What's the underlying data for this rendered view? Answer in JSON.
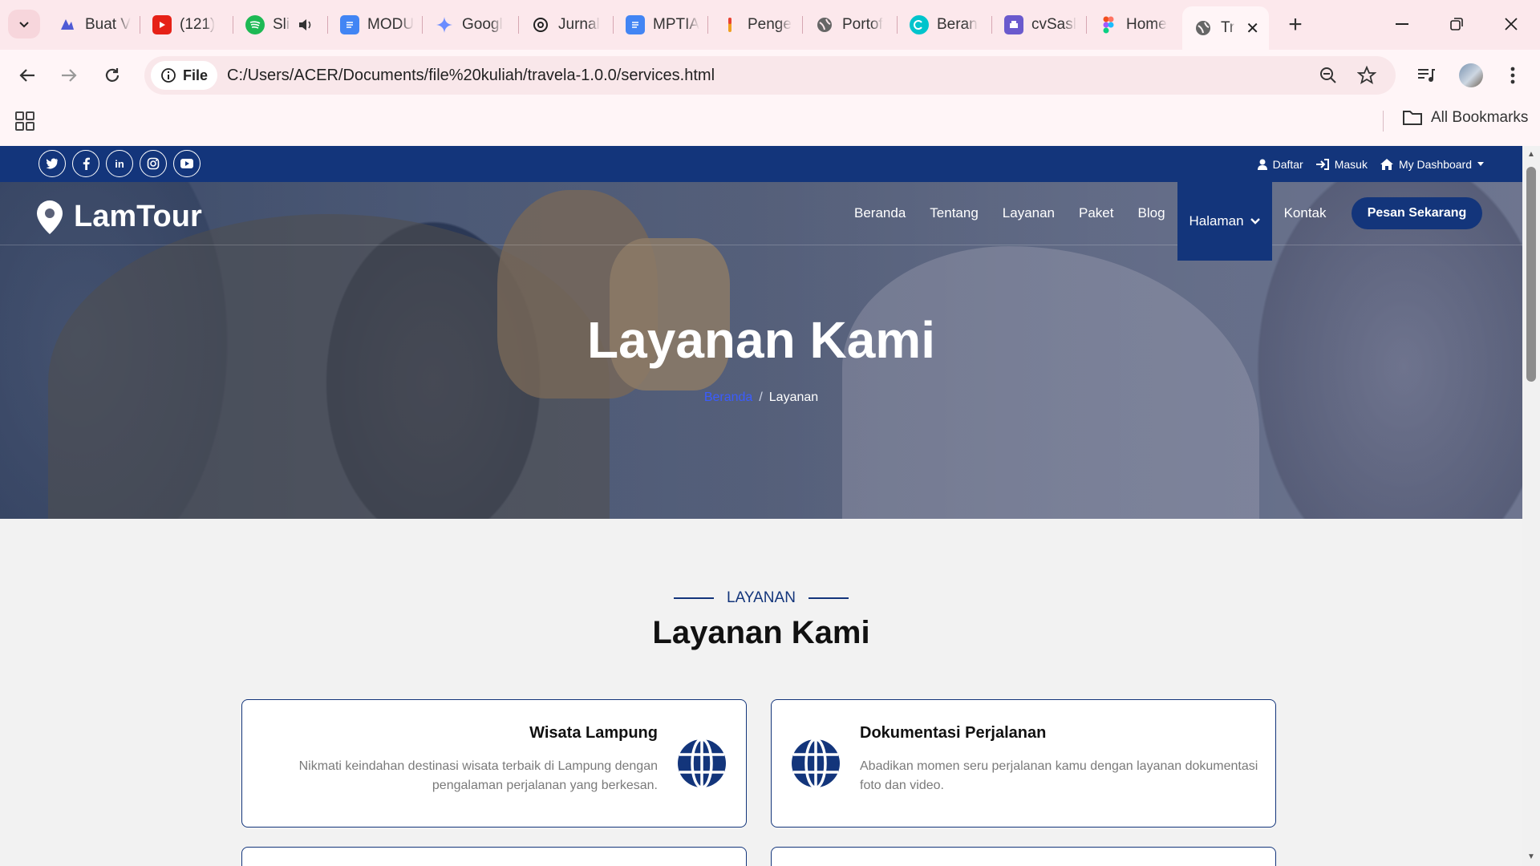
{
  "browser": {
    "tabs": [
      {
        "title": "Buat V",
        "icon": "copilot-icon",
        "color": "#4f5bd5"
      },
      {
        "title": "(121)",
        "icon": "youtube-icon",
        "color": "#e62117"
      },
      {
        "title": "Sli",
        "icon": "spotify-icon",
        "color": "#1db954"
      },
      {
        "title": "MODU",
        "icon": "docs-icon",
        "color": "#4285f4"
      },
      {
        "title": "Googl",
        "icon": "gemini-icon",
        "color": "#6b8cff"
      },
      {
        "title": "Jurnal",
        "icon": "chatgpt-icon",
        "color": "#222222"
      },
      {
        "title": "MPTIA",
        "icon": "docs-icon",
        "color": "#4285f4"
      },
      {
        "title": "Penge",
        "icon": "ai-icon",
        "color": "#f0a020"
      },
      {
        "title": "Portof",
        "icon": "globe-icon",
        "color": "#555555"
      },
      {
        "title": "Beran",
        "icon": "canva-icon",
        "color": "#00c4cc"
      },
      {
        "title": "cvSasl",
        "icon": "print-icon",
        "color": "#6a5acd"
      },
      {
        "title": "Home",
        "icon": "figma-icon",
        "color": "#f24e1e"
      },
      {
        "title": "Tr",
        "icon": "globe-icon",
        "color": "#555555"
      }
    ],
    "url_chip": "File",
    "url": "C:/Users/ACER/Documents/file%20kuliah/travela-1.0.0/services.html",
    "all_bookmarks": "All Bookmarks"
  },
  "topbar": {
    "social": [
      "twitter-icon",
      "facebook-icon",
      "linkedin-icon",
      "instagram-icon",
      "youtube-icon"
    ],
    "links": {
      "register": "Daftar",
      "login": "Masuk",
      "dashboard": "My Dashboard"
    }
  },
  "navbar": {
    "brand": "LamTour",
    "items": [
      "Beranda",
      "Tentang",
      "Layanan",
      "Paket",
      "Blog",
      "Halaman",
      "Kontak"
    ],
    "cta": "Pesan Sekarang"
  },
  "hero": {
    "title": "Layanan Kami",
    "breadcrumb": {
      "home": "Beranda",
      "current": "Layanan"
    }
  },
  "section": {
    "subtitle": "LAYANAN",
    "title": "Layanan Kami"
  },
  "services": [
    {
      "title": "Wisata Lampung",
      "desc_line1": "Nikmati keindahan destinasi wisata terbaik di Lampung dengan",
      "desc_line2": "pengalaman perjalanan yang berkesan."
    },
    {
      "title": "Dokumentasi Perjalanan",
      "desc_line1": "Abadikan momen seru perjalanan kamu dengan layanan dokumentasi",
      "desc_line2": "foto dan video."
    }
  ],
  "colors": {
    "primary": "#13357b",
    "link": "#3a5cff"
  }
}
